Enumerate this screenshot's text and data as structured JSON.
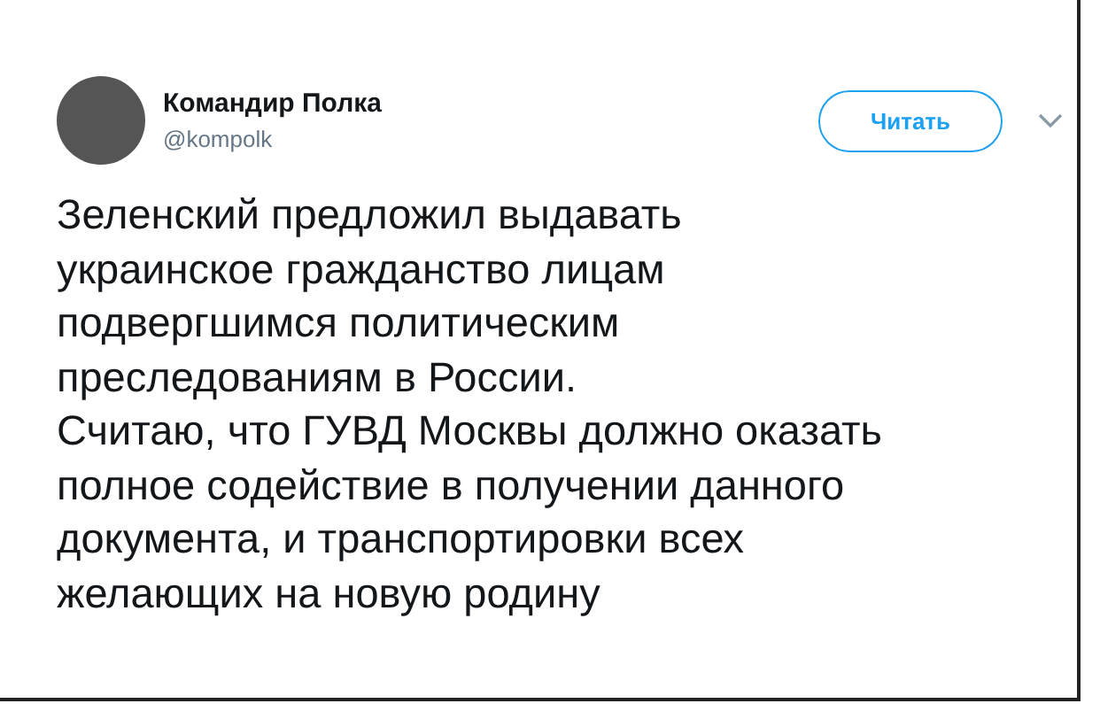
{
  "author": {
    "name": "Командир Полка",
    "handle": "@kompolk"
  },
  "follow_button": {
    "label": "Читать"
  },
  "tweet": {
    "paragraphs": [
      "Зеленский предложил выдавать\nукраинское гражданство лицам\nподвергшимся политическим\nпреследованиям в России.",
      "Считаю, что ГУВД Москвы должно оказать\nполное содействие в получении данного\nдокумента, и транспортировки всех\nжелающих на новую родину"
    ]
  }
}
